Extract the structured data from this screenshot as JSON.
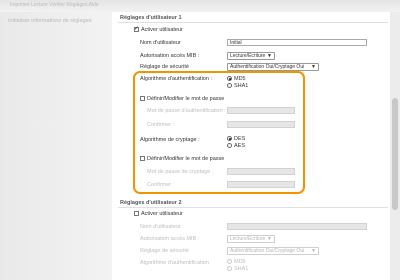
{
  "top_menu": "Imprimer  Lecture  Vérifier  Réglages  Aide",
  "sidebar": {
    "link": "Initialiser informations de réglages"
  },
  "user1": {
    "section_title": "Réglages d'utilisateur 1",
    "activate_label": "Activer utilisateur",
    "username_label": "Nom d'utilisateur",
    "username_value": "Initial",
    "access_label": "Autorisation accès MIB :",
    "access_value": "Lecture/Ecriture",
    "security_label": "Réglage de sécurité",
    "security_value": "Authentification Oui/Cryptage Oui",
    "auth_algo_label": "Algorithme d'authentification :",
    "auth_md5": "MD5",
    "auth_sha1": "SHA1",
    "set_pw_label": "Définir/Modifier le mot de passe",
    "auth_pw_label": "Mot de passe d'authentification :",
    "confirm_label": "Confirmer :",
    "crypto_algo_label": "Algorithme de cryptage :",
    "crypto_des": "DES",
    "crypto_aes": "AES",
    "set_pw2_label": "Définir/Modifier le mot de passe",
    "crypto_pw_label": "Mot de passe de cryptage :",
    "confirm2_label": "Confirmer :"
  },
  "user2": {
    "section_title": "Réglages d'utilisateur 2",
    "activate_label": "Activer utilisateur",
    "username_label": "Nom d'utilisateur",
    "access_label": "Autorisation accès MIB :",
    "access_value": "Lecture/Ecriture",
    "security_label": "Réglage de sécurité",
    "security_value": "Authentification Oui/Cryptage Oui",
    "auth_algo_label": "Algorithme d'authentification",
    "auth_md5": "MD5",
    "auth_sha1": "SHA1"
  },
  "colors": {
    "highlight": "#f29400"
  }
}
